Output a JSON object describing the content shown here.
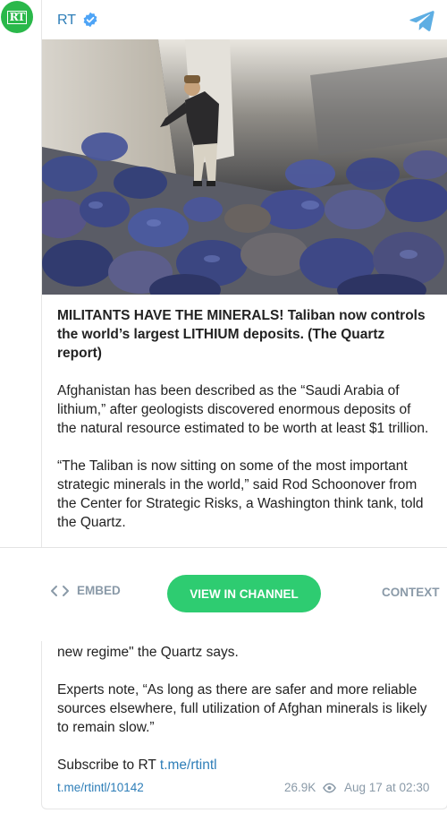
{
  "channel": {
    "name": "RT",
    "avatar_text": "RT"
  },
  "post": {
    "headline": "MILITANTS HAVE THE MINERALS! Taliban now controls the world’s largest LITHIUM deposits. (The Quartz report)",
    "paragraph_1": "Afghanistan has been described as the “Saudi Arabia of lithium,” after geologists discovered enormous deposits of the natural resource estimated to be worth at least $1 trillion.",
    "paragraph_2": "“The Taliban is now sitting on some of the most important strategic minerals in the world,” said Rod Schoonover from the Center for Strategic Risks, a Washington think tank, told the Quartz.",
    "paragraph_3_tail": "new regime\" the Quartz says.",
    "paragraph_4": "Experts note, “As long as there are safer and more reliable sources elsewhere, full utilization of Afghan minerals is likely to remain slow.”",
    "subscribe_text": "Subscribe to RT",
    "subscribe_link": "t.me/rtintl"
  },
  "actions": {
    "embed": "EMBED",
    "view": "VIEW IN CHANNEL",
    "context": "CONTEXT"
  },
  "footer": {
    "post_link": "t.me/rtintl/10142",
    "views": "26.9K",
    "date": "Aug 17 at 02:30"
  },
  "colors": {
    "accent_green": "#2ecc71",
    "avatar_green": "#2ab84a",
    "link_blue": "#2e7eb8",
    "muted_gray": "#8a9aa8"
  }
}
